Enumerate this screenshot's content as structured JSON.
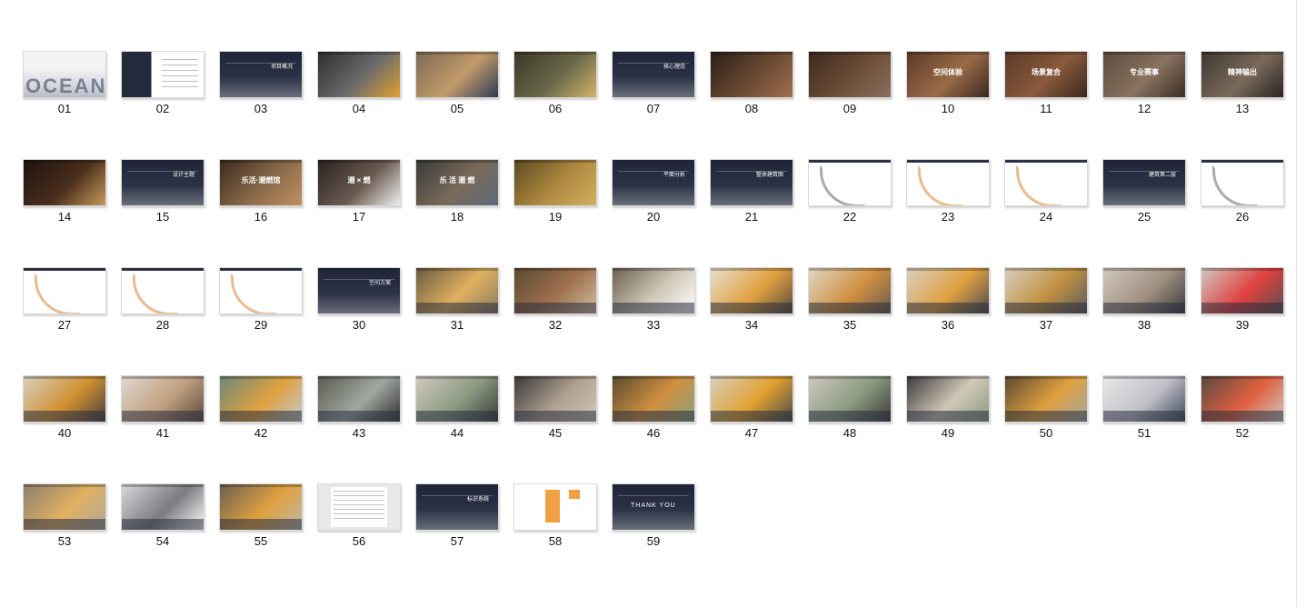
{
  "slides": [
    {
      "num": "01",
      "kind": "cover",
      "title": "OCEAN",
      "colors": [
        "#f4f4f4",
        "#2b3246"
      ]
    },
    {
      "num": "02",
      "kind": "toc",
      "title": "",
      "colors": [
        "#232a3c",
        "#ffffff"
      ]
    },
    {
      "num": "03",
      "kind": "section",
      "title": "项目概况",
      "colors": [
        "#202739",
        "#404656"
      ]
    },
    {
      "num": "04",
      "kind": "photo",
      "title": "",
      "colors": [
        "#2d2d2d",
        "#6c6c6c",
        "#e0a030"
      ]
    },
    {
      "num": "05",
      "kind": "photo",
      "title": "",
      "colors": [
        "#7d6a55",
        "#c29a6a",
        "#2f3b55"
      ]
    },
    {
      "num": "06",
      "kind": "photo",
      "title": "",
      "colors": [
        "#3b3626",
        "#6a6a4a",
        "#d4b26a"
      ]
    },
    {
      "num": "07",
      "kind": "section",
      "title": "核心理念",
      "colors": [
        "#202739",
        "#404656"
      ]
    },
    {
      "num": "08",
      "kind": "photo",
      "title": "",
      "colors": [
        "#2a1f18",
        "#6b4a33",
        "#a07050"
      ]
    },
    {
      "num": "09",
      "kind": "photo",
      "title": "",
      "colors": [
        "#3a2a1e",
        "#6e4e36",
        "#8a7060"
      ]
    },
    {
      "num": "10",
      "kind": "photo",
      "title": "空间体验",
      "colors": [
        "#5a3a28",
        "#9a6a48",
        "#3a281e"
      ]
    },
    {
      "num": "11",
      "kind": "photo",
      "title": "场景复合",
      "colors": [
        "#5a3a28",
        "#8a5a3c",
        "#3a281e"
      ]
    },
    {
      "num": "12",
      "kind": "photo",
      "title": "专业赛事",
      "colors": [
        "#5a4a3c",
        "#8a7360",
        "#3a2e24"
      ]
    },
    {
      "num": "13",
      "kind": "photo",
      "title": "精神输出",
      "colors": [
        "#3e3630",
        "#7a6a5c",
        "#2a2420"
      ]
    },
    {
      "num": "14",
      "kind": "photo",
      "title": "",
      "colors": [
        "#1c1410",
        "#4a2e1c",
        "#c79a5a"
      ]
    },
    {
      "num": "15",
      "kind": "section",
      "title": "设计主题",
      "colors": [
        "#202739",
        "#404656"
      ]
    },
    {
      "num": "16",
      "kind": "photo",
      "title": "乐活·潮燃馆",
      "colors": [
        "#3a2a1c",
        "#8a6a4a",
        "#c09060"
      ]
    },
    {
      "num": "17",
      "kind": "photo",
      "title": "潮 × 燃",
      "colors": [
        "#2a2220",
        "#6a5a50",
        "#f0f0f0"
      ]
    },
    {
      "num": "18",
      "kind": "photo",
      "title": "乐 活 潮 燃",
      "colors": [
        "#3a3a3a",
        "#7a6a5a",
        "#5a6a7a"
      ]
    },
    {
      "num": "19",
      "kind": "photo",
      "title": "",
      "colors": [
        "#5a4a20",
        "#b08a40",
        "#d0b060"
      ]
    },
    {
      "num": "20",
      "kind": "section",
      "title": "平面分析",
      "colors": [
        "#202739",
        "#404656"
      ]
    },
    {
      "num": "21",
      "kind": "section",
      "title": "整体建筑图",
      "colors": [
        "#202739",
        "#3a4052"
      ]
    },
    {
      "num": "22",
      "kind": "plan",
      "title": "",
      "colors": [
        "#ffffff",
        "#888888"
      ]
    },
    {
      "num": "23",
      "kind": "plan",
      "title": "",
      "colors": [
        "#ffffff",
        "#e0a060"
      ]
    },
    {
      "num": "24",
      "kind": "plan",
      "title": "",
      "colors": [
        "#ffffff",
        "#e0a060"
      ]
    },
    {
      "num": "25",
      "kind": "section",
      "title": "建筑第二层",
      "colors": [
        "#202739",
        "#3a4052"
      ]
    },
    {
      "num": "26",
      "kind": "plan",
      "title": "",
      "colors": [
        "#ffffff",
        "#888888"
      ]
    },
    {
      "num": "27",
      "kind": "plan",
      "title": "",
      "colors": [
        "#ffffff",
        "#e0a060"
      ]
    },
    {
      "num": "28",
      "kind": "plan",
      "title": "",
      "colors": [
        "#ffffff",
        "#e0a060"
      ]
    },
    {
      "num": "29",
      "kind": "plan",
      "title": "",
      "colors": [
        "#ffffff",
        "#e0a060"
      ]
    },
    {
      "num": "30",
      "kind": "section",
      "title": "空间方案",
      "colors": [
        "#202739",
        "#404656"
      ]
    },
    {
      "num": "31",
      "kind": "render",
      "title": "",
      "colors": [
        "#6a5a40",
        "#e0b060",
        "#8a7a60"
      ]
    },
    {
      "num": "32",
      "kind": "render",
      "title": "",
      "colors": [
        "#5a4a30",
        "#a07050",
        "#d0c0a0"
      ]
    },
    {
      "num": "33",
      "kind": "render",
      "title": "",
      "colors": [
        "#6a6050",
        "#d0c8b8",
        "#ffffff"
      ]
    },
    {
      "num": "34",
      "kind": "render",
      "title": "",
      "colors": [
        "#e8e0d0",
        "#e0a040",
        "#5a4a40"
      ]
    },
    {
      "num": "35",
      "kind": "render",
      "title": "",
      "colors": [
        "#e0d8c8",
        "#d09040",
        "#6a5a50"
      ]
    },
    {
      "num": "36",
      "kind": "render",
      "title": "",
      "colors": [
        "#d8d0c0",
        "#e0a040",
        "#4a4a50"
      ]
    },
    {
      "num": "37",
      "kind": "render",
      "title": "",
      "colors": [
        "#d8d0c0",
        "#c09040",
        "#5a5a60"
      ]
    },
    {
      "num": "38",
      "kind": "render",
      "title": "",
      "colors": [
        "#d0c8c0",
        "#a09080",
        "#3a3a40"
      ]
    },
    {
      "num": "39",
      "kind": "render",
      "title": "",
      "colors": [
        "#d0c8c0",
        "#e04040",
        "#5a5050"
      ]
    },
    {
      "num": "40",
      "kind": "render",
      "title": "",
      "colors": [
        "#d8d0c0",
        "#d09030",
        "#4a4040"
      ]
    },
    {
      "num": "41",
      "kind": "render",
      "title": "",
      "colors": [
        "#e0d8d0",
        "#c0a080",
        "#5a4a40"
      ]
    },
    {
      "num": "42",
      "kind": "render",
      "title": "",
      "colors": [
        "#6a8a7a",
        "#e0a040",
        "#c0c8d0"
      ]
    },
    {
      "num": "43",
      "kind": "render",
      "title": "",
      "colors": [
        "#5a5a50",
        "#a0a8a0",
        "#303030"
      ]
    },
    {
      "num": "44",
      "kind": "render",
      "title": "",
      "colors": [
        "#d0c8c0",
        "#8a9a80",
        "#3a3a3a"
      ]
    },
    {
      "num": "45",
      "kind": "render",
      "title": "",
      "colors": [
        "#3a3a3a",
        "#b0a090",
        "#d0c8b8"
      ]
    },
    {
      "num": "46",
      "kind": "render",
      "title": "",
      "colors": [
        "#5a4a30",
        "#d09040",
        "#8aa080"
      ]
    },
    {
      "num": "47",
      "kind": "render",
      "title": "",
      "colors": [
        "#d8d0c0",
        "#e0a030",
        "#4a4a4a"
      ]
    },
    {
      "num": "48",
      "kind": "render",
      "title": "",
      "colors": [
        "#d0c8c0",
        "#8a9a80",
        "#3a3a3a"
      ]
    },
    {
      "num": "49",
      "kind": "render",
      "title": "",
      "colors": [
        "#3a3a3a",
        "#d0c8b8",
        "#8a9a80"
      ]
    },
    {
      "num": "50",
      "kind": "render",
      "title": "",
      "colors": [
        "#5a4a30",
        "#e0a040",
        "#a0a8a0"
      ]
    },
    {
      "num": "51",
      "kind": "render",
      "title": "",
      "colors": [
        "#e8e8e8",
        "#c0c0c8",
        "#404858"
      ]
    },
    {
      "num": "52",
      "kind": "render",
      "title": "",
      "colors": [
        "#5a4a40",
        "#e06040",
        "#d0c8c0"
      ]
    },
    {
      "num": "53",
      "kind": "render",
      "title": "",
      "colors": [
        "#8a8070",
        "#e0b060",
        "#b0a8a0"
      ]
    },
    {
      "num": "54",
      "kind": "render",
      "title": "",
      "colors": [
        "#d8d8d8",
        "#7a7a80",
        "#ffffff"
      ]
    },
    {
      "num": "55",
      "kind": "render",
      "title": "",
      "colors": [
        "#6a6050",
        "#e0a040",
        "#c0b8a8"
      ]
    },
    {
      "num": "56",
      "kind": "table",
      "title": "",
      "colors": [
        "#e8e8e8",
        "#ffffff",
        "#8a8a8a"
      ]
    },
    {
      "num": "57",
      "kind": "section",
      "title": "标识系统",
      "colors": [
        "#202739",
        "#404656"
      ]
    },
    {
      "num": "58",
      "kind": "signage",
      "title": "",
      "colors": [
        "#ffffff",
        "#f0a040"
      ]
    },
    {
      "num": "59",
      "kind": "thanks",
      "title": "THANK YOU",
      "colors": [
        "#202739",
        "#404656"
      ]
    }
  ]
}
